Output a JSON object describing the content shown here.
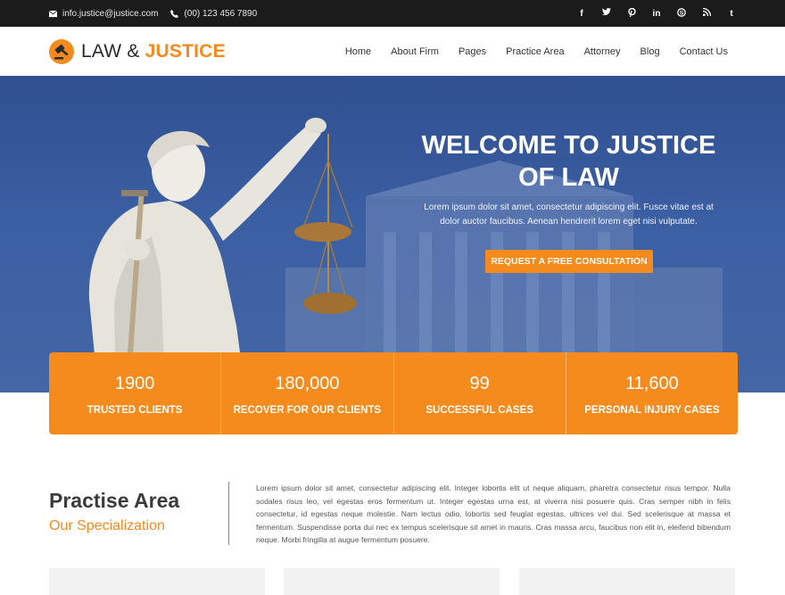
{
  "topbar": {
    "email": "info.justice@justice.com",
    "phone": "(00) 123 456 7890",
    "social": [
      "f",
      "t",
      "p",
      "in",
      "s",
      "rss",
      "t"
    ]
  },
  "header": {
    "logo_text": "LAW &",
    "logo_accent": "JUSTICE",
    "nav": [
      "Home",
      "About Firm",
      "Pages",
      "Practice Area",
      "Attorney",
      "Blog",
      "Contact Us"
    ]
  },
  "hero": {
    "title_line1": "WELCOME TO JUSTICE",
    "title_line2": "OF LAW",
    "subtitle": "Lorem ipsum dolor sit amet, consectetur adipiscing elit. Fusce vitae est at dolor auctor faucibus. Aenean hendrerit lorem eget nisi vulputate.",
    "button": "REQUEST A FREE CONSULTATION"
  },
  "stats": [
    {
      "number": "1900",
      "label": "TRUSTED CLIENTS"
    },
    {
      "number": "180,000",
      "label": "RECOVER FOR OUR CLIENTS"
    },
    {
      "number": "99",
      "label": "SUCCESSFUL CASES"
    },
    {
      "number": "11,600",
      "label": "PERSONAL INJURY CASES"
    }
  ],
  "practise": {
    "title": "Practise Area",
    "subtitle": "Our Specialization",
    "text": "Lorem ipsum dolor sit amet, consectetur adipiscing elit. Integer lobortis elit ut neque aliquam, pharetra consectetur risus tempor. Nulla sodales risus leo, vel egestas eros fermentum ut. Integer egestas urna est, at viverra nisi posuere quis. Cras semper nibh in felis consectetur, id egestas neque molestie. Nam lectus odio, lobortis sed feugiat egestas, ultrices vel dui. Sed scelerisque at massa et fermentum. Suspendisse porta dui nec ex tempus scelerisque sit amet in mauris. Cras massa arcu, faucibus non elit in, eleifend bibendum neque. Morbi fringilla at augue fermentum posuere."
  },
  "colors": {
    "accent": "#f58b1c",
    "topbar": "#1b1b1b",
    "hero_blue": "#3b5fa3"
  }
}
